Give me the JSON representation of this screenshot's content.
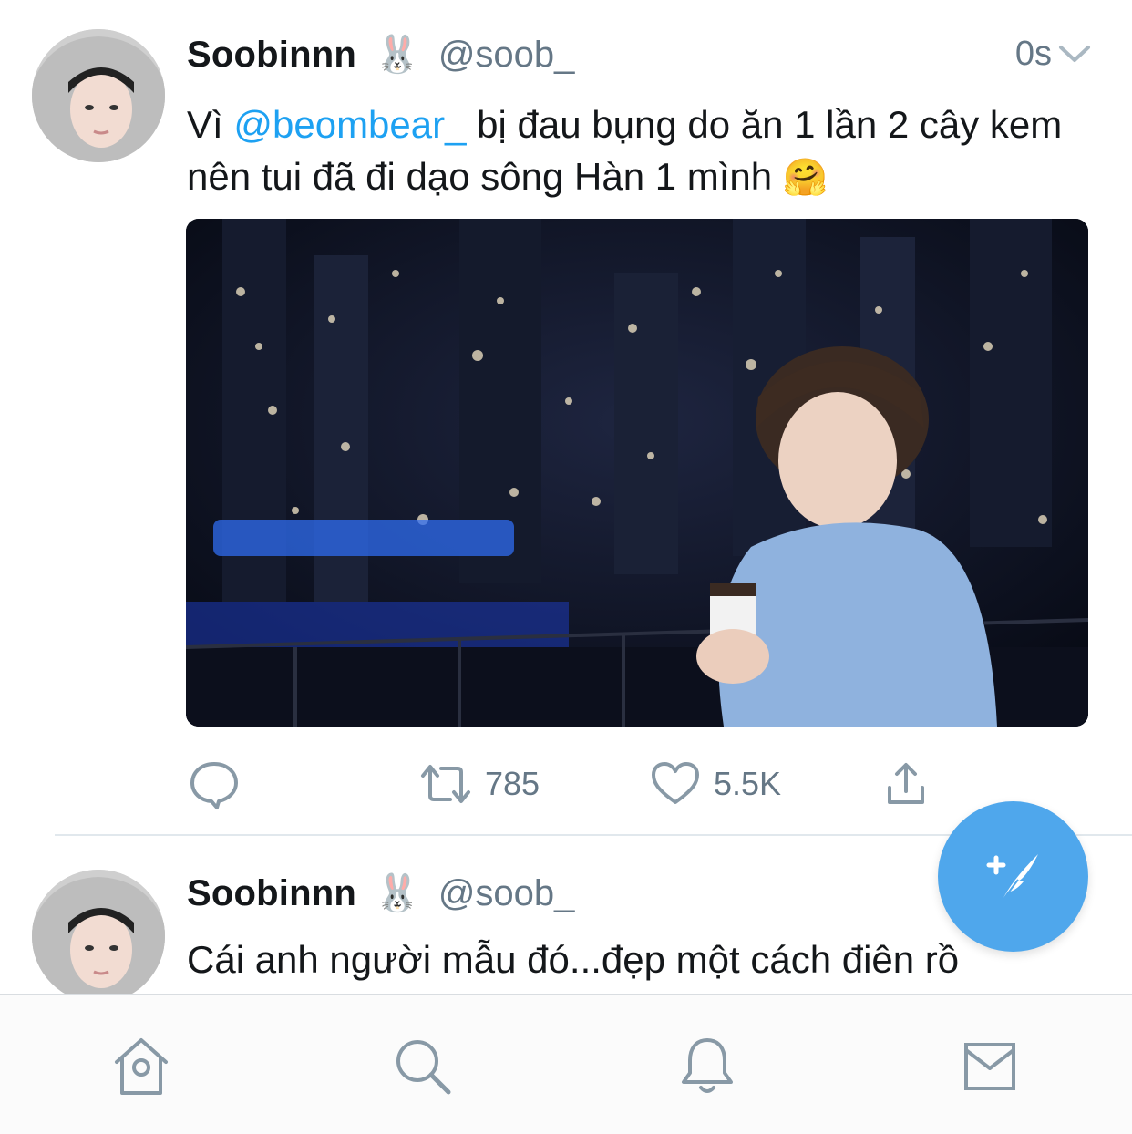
{
  "tweets": [
    {
      "display_name": "Soobinnn",
      "name_emoji": "🐰",
      "handle": "@soob_",
      "time": "0s",
      "text_before": "Vì ",
      "mention": "@beombear_",
      "text_after": " bị đau bụng do ăn 1 lần 2 cây kem nên tui đã đi dạo sông Hàn 1 mình",
      "text_emoji": "🤗",
      "retweets": "785",
      "likes": "5.5K"
    },
    {
      "display_name": "Soobinnn",
      "name_emoji": "🐰",
      "handle": "@soob_",
      "text": "Cái anh người mẫu đó...đẹp một cách điên rồ"
    }
  ],
  "icons": {
    "reply": "reply-icon",
    "retweet": "retweet-icon",
    "like": "heart-icon",
    "share": "share-icon",
    "compose": "compose-tweet-icon",
    "tabs": [
      "home-icon",
      "search-icon",
      "notifications-icon",
      "messages-icon"
    ]
  },
  "colors": {
    "accent": "#1da1f2",
    "fab": "#4fa7ec",
    "secondary_text": "#657786",
    "divider": "#e1e8ed"
  }
}
